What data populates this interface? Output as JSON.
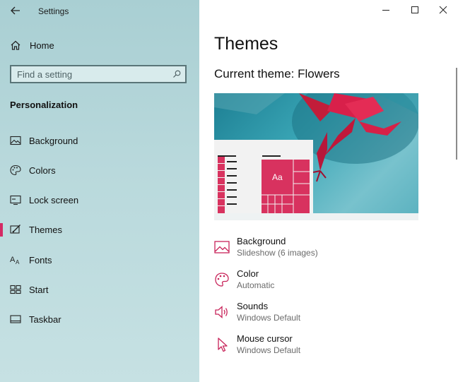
{
  "window": {
    "title": "Settings",
    "minimize_icon": "minimize-icon",
    "maximize_icon": "maximize-icon",
    "close_icon": "close-icon"
  },
  "sidebar": {
    "home_label": "Home",
    "search_placeholder": "Find a setting",
    "section_title": "Personalization",
    "items": [
      {
        "label": "Background",
        "icon": "picture-icon"
      },
      {
        "label": "Colors",
        "icon": "palette-icon"
      },
      {
        "label": "Lock screen",
        "icon": "lock-screen-icon"
      },
      {
        "label": "Themes",
        "icon": "themes-icon",
        "active": true
      },
      {
        "label": "Fonts",
        "icon": "fonts-icon"
      },
      {
        "label": "Start",
        "icon": "start-icon"
      },
      {
        "label": "Taskbar",
        "icon": "taskbar-icon"
      }
    ]
  },
  "main": {
    "page_title": "Themes",
    "current_theme": "Current theme: Flowers",
    "preview_tile_text": "Aa",
    "settings": [
      {
        "name": "Background",
        "value": "Slideshow (6 images)",
        "icon": "picture-icon"
      },
      {
        "name": "Color",
        "value": "Automatic",
        "icon": "palette-icon"
      },
      {
        "name": "Sounds",
        "value": "Windows Default",
        "icon": "speaker-icon"
      },
      {
        "name": "Mouse cursor",
        "value": "Windows Default",
        "icon": "cursor-icon"
      }
    ]
  },
  "colors": {
    "accent": "#d42a64",
    "sidebar_bg": "#b9d9dc"
  }
}
